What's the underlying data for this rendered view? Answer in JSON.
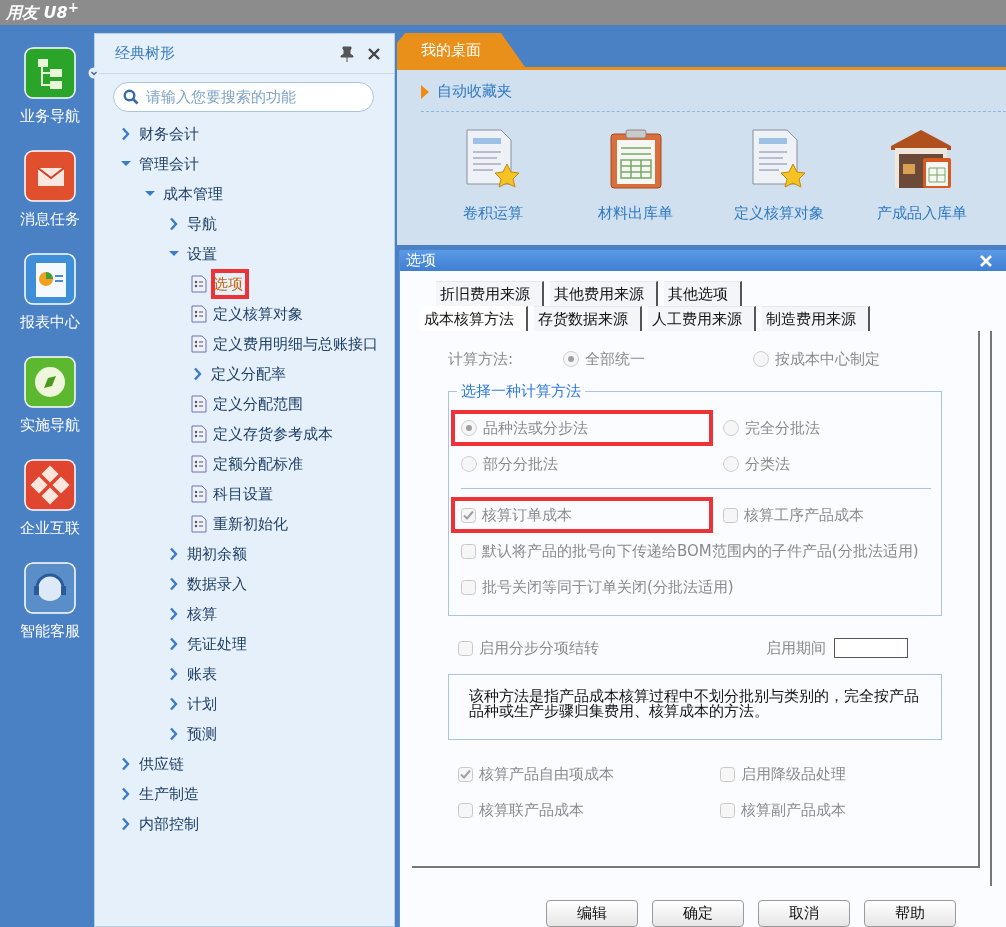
{
  "app_title": "用友 U8$^{+}$",
  "nav_rail": [
    {
      "label": "业务导航",
      "dropdown": true
    },
    {
      "label": "消息任务",
      "dropdown": false
    },
    {
      "label": "报表中心",
      "dropdown": false
    },
    {
      "label": "实施导航",
      "dropdown": false
    },
    {
      "label": "企业互联",
      "dropdown": false
    },
    {
      "label": "智能客服",
      "dropdown": false
    }
  ],
  "tree": {
    "title": "经典树形",
    "search": {
      "placeholder": "请输入您要搜索的功能"
    },
    "items": [
      {
        "label": "财务会计",
        "kind": "folder",
        "expanded": false,
        "selected": false,
        "highlighted": false
      },
      {
        "label": "管理会计",
        "kind": "folder",
        "expanded": true,
        "selected": false,
        "highlighted": false,
        "children": [
          {
            "label": "成本管理",
            "kind": "folder",
            "expanded": true,
            "selected": false,
            "highlighted": false,
            "children": [
              {
                "label": "导航",
                "kind": "folder",
                "expanded": false,
                "selected": false,
                "highlighted": false
              },
              {
                "label": "设置",
                "kind": "folder",
                "expanded": true,
                "selected": false,
                "highlighted": false,
                "children": [
                  {
                    "label": "选项",
                    "kind": "leaf",
                    "selected": true,
                    "highlighted": true
                  },
                  {
                    "label": "定义核算对象",
                    "kind": "leaf",
                    "selected": false,
                    "highlighted": false
                  },
                  {
                    "label": "定义费用明细与总账接口",
                    "kind": "leaf",
                    "selected": false,
                    "highlighted": false
                  },
                  {
                    "label": "定义分配率",
                    "kind": "folder",
                    "expanded": false,
                    "selected": false,
                    "highlighted": false
                  },
                  {
                    "label": "定义分配范围",
                    "kind": "leaf",
                    "selected": false,
                    "highlighted": false
                  },
                  {
                    "label": "定义存货参考成本",
                    "kind": "leaf",
                    "selected": false,
                    "highlighted": false
                  },
                  {
                    "label": "定额分配标准",
                    "kind": "leaf",
                    "selected": false,
                    "highlighted": false
                  },
                  {
                    "label": "科目设置",
                    "kind": "leaf",
                    "selected": false,
                    "highlighted": false
                  },
                  {
                    "label": "重新初始化",
                    "kind": "leaf",
                    "selected": false,
                    "highlighted": false
                  }
                ]
              },
              {
                "label": "期初余额",
                "kind": "folder",
                "expanded": false,
                "selected": false,
                "highlighted": false
              },
              {
                "label": "数据录入",
                "kind": "folder",
                "expanded": false,
                "selected": false,
                "highlighted": false
              },
              {
                "label": "核算",
                "kind": "folder",
                "expanded": false,
                "selected": false,
                "highlighted": false
              },
              {
                "label": "凭证处理",
                "kind": "folder",
                "expanded": false,
                "selected": false,
                "highlighted": false
              },
              {
                "label": "账表",
                "kind": "folder",
                "expanded": false,
                "selected": false,
                "highlighted": false
              },
              {
                "label": "计划",
                "kind": "folder",
                "expanded": false,
                "selected": false,
                "highlighted": false
              },
              {
                "label": "预测",
                "kind": "folder",
                "expanded": false,
                "selected": false,
                "highlighted": false
              }
            ]
          }
        ]
      },
      {
        "label": "供应链",
        "kind": "folder",
        "expanded": false,
        "selected": false,
        "highlighted": false
      },
      {
        "label": "生产制造",
        "kind": "folder",
        "expanded": false,
        "selected": false,
        "highlighted": false
      },
      {
        "label": "内部控制",
        "kind": "folder",
        "expanded": false,
        "selected": false,
        "highlighted": false
      }
    ]
  },
  "workspace_tabs": [
    {
      "label": "我的桌面",
      "selected": true
    }
  ],
  "favorites": {
    "title": "自动收藏夹",
    "shortcuts": [
      "卷积运算",
      "材料出库单",
      "定义核算对象",
      "产成品入库单"
    ]
  },
  "dialog": {
    "title": "选项",
    "tab_rows": [
      [
        {
          "label": "折旧费用来源",
          "selected": false
        },
        {
          "label": "其他费用来源",
          "selected": false
        },
        {
          "label": "其他选项",
          "selected": false
        }
      ],
      [
        {
          "label": "成本核算方法",
          "selected": true
        },
        {
          "label": "存货数据来源",
          "selected": false
        },
        {
          "label": "人工费用来源",
          "selected": false
        },
        {
          "label": "制造费用来源",
          "selected": false
        }
      ]
    ],
    "disabled": true,
    "calc_method": {
      "label": "计算方法:",
      "options": [
        {
          "label": "全部统一",
          "selected": true
        },
        {
          "label": "按成本中心制定",
          "selected": false
        }
      ]
    },
    "method_group": {
      "legend": "选择一种计算方法",
      "options": [
        {
          "label": "品种法或分步法",
          "selected": true,
          "highlighted": true
        },
        {
          "label": "完全分批法",
          "selected": false,
          "highlighted": false
        },
        {
          "label": "部分分批法",
          "selected": false,
          "highlighted": false
        },
        {
          "label": "分类法",
          "selected": false,
          "highlighted": false
        }
      ],
      "checks": [
        {
          "label": "核算订单成本",
          "checked": true,
          "highlighted": true
        },
        {
          "label": "核算工序产品成本",
          "checked": false,
          "highlighted": false
        },
        {
          "label": "默认将产品的批号向下传递给BOM范围内的子件产品(分批法适用)",
          "checked": false,
          "highlighted": false
        },
        {
          "label": "批号关闭等同于订单关闭(分批法适用)",
          "checked": false,
          "highlighted": false
        }
      ]
    },
    "stepwise": {
      "label": "启用分步分项结转",
      "checked": false
    },
    "period": {
      "label": "启用期间"
    },
    "description": "该种方法是指产品成本核算过程中不划分批别与类别的，完全按产品品种或生产步骤归集费用、核算成本的方法。",
    "extra_checks": [
      {
        "label": "核算产品自由项成本",
        "checked": true
      },
      {
        "label": "启用降级品处理",
        "checked": false
      },
      {
        "label": "核算联产品成本",
        "checked": false
      },
      {
        "label": "核算副产品成本",
        "checked": false
      }
    ],
    "buttons": [
      "编辑",
      "确定",
      "取消",
      "帮助"
    ]
  }
}
